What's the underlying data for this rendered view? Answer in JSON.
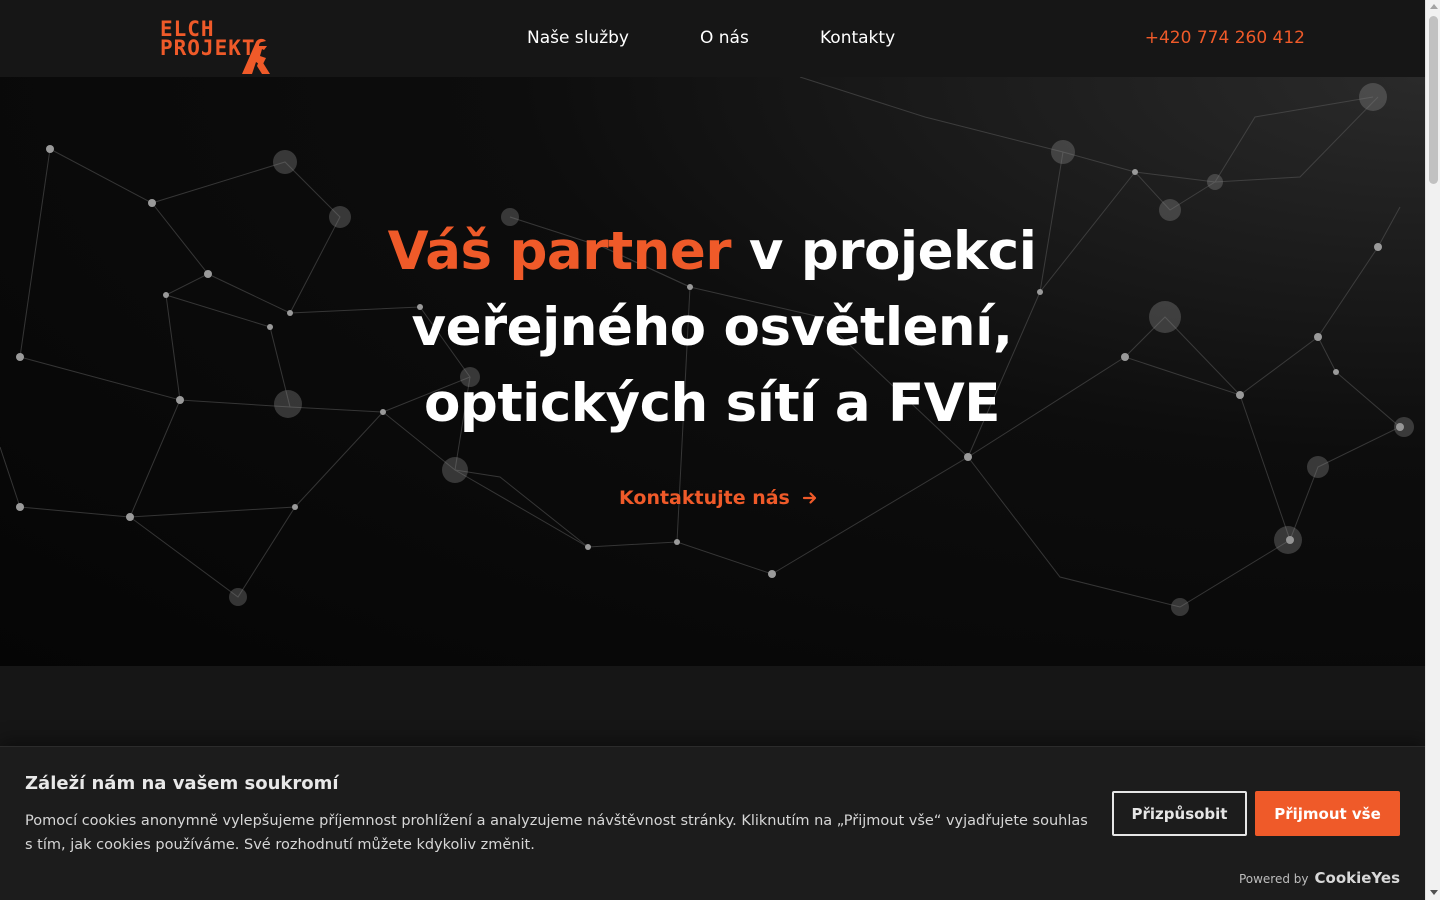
{
  "header": {
    "logo_line1": "ELCH",
    "logo_line2": "PROJEKT",
    "nav": [
      "Naše služby",
      "O nás",
      "Kontakty"
    ],
    "phone": "+420 774 260 412"
  },
  "hero": {
    "title_accent": "Váš partner",
    "title_rest_line1": " v projekci",
    "title_line2": "veřejného osvětlení,",
    "title_line3": "optických sítí a FVE",
    "cta_label": "Kontaktujte nás"
  },
  "cookie": {
    "title": "Záleží nám na vašem soukromí",
    "text": "Pomocí cookies anonymně vylepšujeme příjemnost prohlížení a analyzujeme návštěvnost stránky. Kliknutím na „Přijmout vše“ vyjadřujete souhlas s tím, jak cookies používáme. Své rozhodnutí můžete kdykoliv změnit.",
    "customize_label": "Přizpůsobit",
    "accept_label": "Přijmout vše",
    "powered_label": "Powered by",
    "powered_brand": "CookieYes"
  },
  "colors": {
    "accent": "#ef5a29",
    "background": "#161616",
    "hero_background": "#050505"
  },
  "icons": {
    "cta": "arrow-right-icon",
    "logo": "elch-logo-icon"
  }
}
